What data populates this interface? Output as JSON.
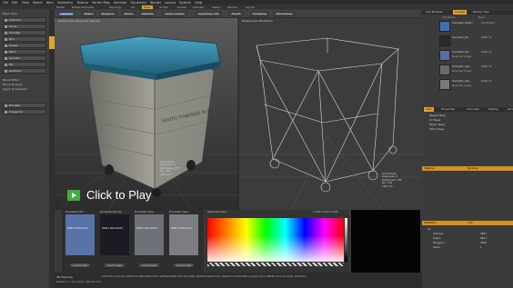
{
  "menu": [
    "File",
    "Edit",
    "View",
    "Select",
    "Item",
    "Geometry",
    "Texture",
    "Vertex Map",
    "Animate",
    "Dynamics",
    "Render",
    "Layout",
    "System",
    "Help"
  ],
  "layout_tabs": [
    "Model",
    "Model Duplicate",
    "Topology",
    "UV",
    "Paint",
    "Sculpt",
    "Games",
    "Animate",
    "Setup",
    "Render",
    "Layout"
  ],
  "active_layout_tab": "Paint",
  "toolbar": {
    "items": [
      "Vertices",
      "Edges",
      "Polygons",
      "Items",
      "Material",
      "Action Center",
      "Symmetry: Off",
      "Falloff",
      "Snapping",
      "Work Plane"
    ]
  },
  "left_tools": {
    "section_label": "Paint Tools",
    "buttons": [
      "Airbrush",
      "Clone",
      "Smudge",
      "Blur",
      "Eraser",
      "Paint",
      "Smooth",
      "Fill",
      "Gradient"
    ],
    "group_labels": [
      "Brush Editor",
      "Brush Browser",
      "Apply To Selection"
    ],
    "bottom_buttons": [
      "Brushes",
      "Image Ink"
    ]
  },
  "viewport_left": {
    "header": "Perspective    Advanced OpenGL",
    "info": "All Vertices\nChannels: 0\nDeformers: OFF\nGL: 710\n100 mm"
  },
  "viewport_right": {
    "header": "Perspective    Wireframe",
    "info": "All Vertices\nChannels: 0\nDeformers: OFF\nGL: 710\n100 mm"
  },
  "dumpster_text": "SOUTH TYNESIDE M.B.C.",
  "play_overlay": {
    "label": "Click to Play",
    "color": "#3fae3f"
  },
  "image_strip": {
    "thumbs": [
      {
        "label": "Dumpster_Dif...",
        "info": "RGB 1024x1024",
        "button": "Load Image"
      },
      {
        "label": "Dumpster_Bump",
        "info": "RGB 1024x1024",
        "button": "Load Image"
      },
      {
        "label": "Dumpster_Spe...",
        "info": "RGB 1024x1024",
        "button": "Load Image"
      },
      {
        "label": "Dumpster_Spe...",
        "info": "RGB 1024x1024",
        "button": "Load Image"
      }
    ]
  },
  "color_panel": {
    "header": "Default Colors",
    "value_readout": "0.225 0.225 0.225"
  },
  "status_bar": {
    "title": "3D Tracking",
    "position": "Position X, Y, Z: 1.10 m, 700 mm, 0 m",
    "hints": "Left Click and Drag: setXYAxis  Left Double Click: setTilted  Right Click and Drag: setTilted  Right Click: Viewport Context Menu (popup menu)  Middle Click and Drag: setXYAxis"
  },
  "right_panel": {
    "top_tabs": [
      "Clip Browser",
      "Images",
      "Shader Tree"
    ],
    "active_top_tab": "Images",
    "columns": [
      "Clip Name",
      "Pixel"
    ],
    "clips": [
      {
        "name": "Dumpster_Object",
        "res": "1024x1024"
      },
      {
        "name": "Dumpster_Bu...",
        "res": "RGBA 32"
      },
      {
        "name": "Dumpster_Dif...",
        "res": "RGBA 32"
      },
      {
        "name": "Dumpster_Spe...",
        "res": "RGBA 32"
      },
      {
        "name": "Dumpster_Spe...",
        "res": "RGBA 32"
      }
    ],
    "sub_clips": [
      "Projected Image",
      "Projected Image",
      "Projected Image"
    ],
    "list_tabs": [
      "Lists",
      "Properties",
      "Channels",
      "Display",
      "Groups"
    ],
    "vertex_map_items": [
      "Weight Maps",
      "UV Maps",
      "Morph Maps",
      "Other Maps"
    ],
    "pipeline_label": "Pipeline",
    "pipeline_tab": "Params",
    "stats_label": "Statistics",
    "stats_tab": "Info",
    "stats_rows": [
      {
        "label": "All",
        "value": ""
      },
      {
        "label": "Vertices",
        "value": "4827"
      },
      {
        "label": "Edges",
        "value": "9647"
      },
      {
        "label": "Polygons",
        "value": "4826"
      },
      {
        "label": "Items",
        "value": "1"
      }
    ]
  },
  "colors": {
    "accent_orange": "#e0a42a",
    "panel_bg": "#3b3b3b",
    "dumpster_lid": "#2f7fa0",
    "dumpster_body": "#8d8d86"
  }
}
